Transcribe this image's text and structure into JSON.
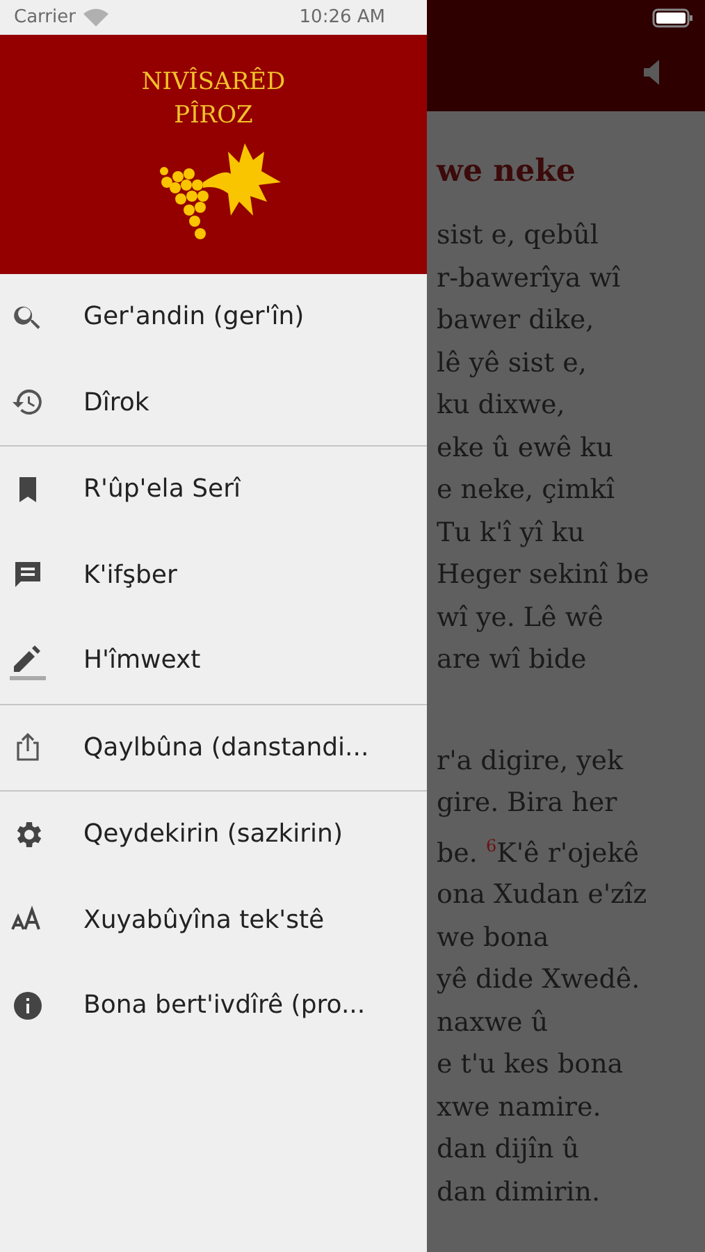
{
  "status_bar": {
    "carrier": "Carrier",
    "time": "10:26 AM"
  },
  "drawer": {
    "title_lines": [
      "NIVÎSARÊD",
      "PÎROZ"
    ],
    "groups": [
      [
        {
          "kind": "search",
          "label": "Ger'andin (ger'în)"
        },
        {
          "kind": "history",
          "label": "Dîrok"
        }
      ],
      [
        {
          "kind": "bookmark",
          "label": "R'ûp'ela Serî"
        },
        {
          "kind": "comment",
          "label": "K'ifşber"
        },
        {
          "kind": "edit",
          "label": "H'îmwext"
        }
      ],
      [
        {
          "kind": "share",
          "label": "Qaylbûna (danstandi..."
        }
      ],
      [
        {
          "kind": "settings",
          "label": "Qeydekirin (sazkirin)"
        },
        {
          "kind": "textsize",
          "label": "Xuyabûyîna tek'stê"
        },
        {
          "kind": "info",
          "label": "Bona bert'ivdîrê (pro..."
        }
      ]
    ]
  },
  "reader": {
    "heading": "we neke",
    "paragraphs": [
      [
        "sist e, qebûl",
        "r-bawerîya wî",
        "bawer dike,",
        "lê yê sist e,",
        "ku dixwe,",
        "eke û ewê ku",
        "e neke, çimkî",
        "Tu k'î yî ku",
        "Heger sekinî be",
        "wî ye. Lê wê",
        "are wî bide"
      ],
      [
        "r'a digire, yek",
        "gire. Bira her",
        "be. $^{6}$K'ê r'ojekê",
        "ona Xudan e'zîz",
        "we bona",
        "yê dide Xwedê.",
        "naxwe û",
        "e t'u kes bona",
        "xwe namire.",
        "dan dijîn û",
        "dan dimirin."
      ]
    ]
  }
}
